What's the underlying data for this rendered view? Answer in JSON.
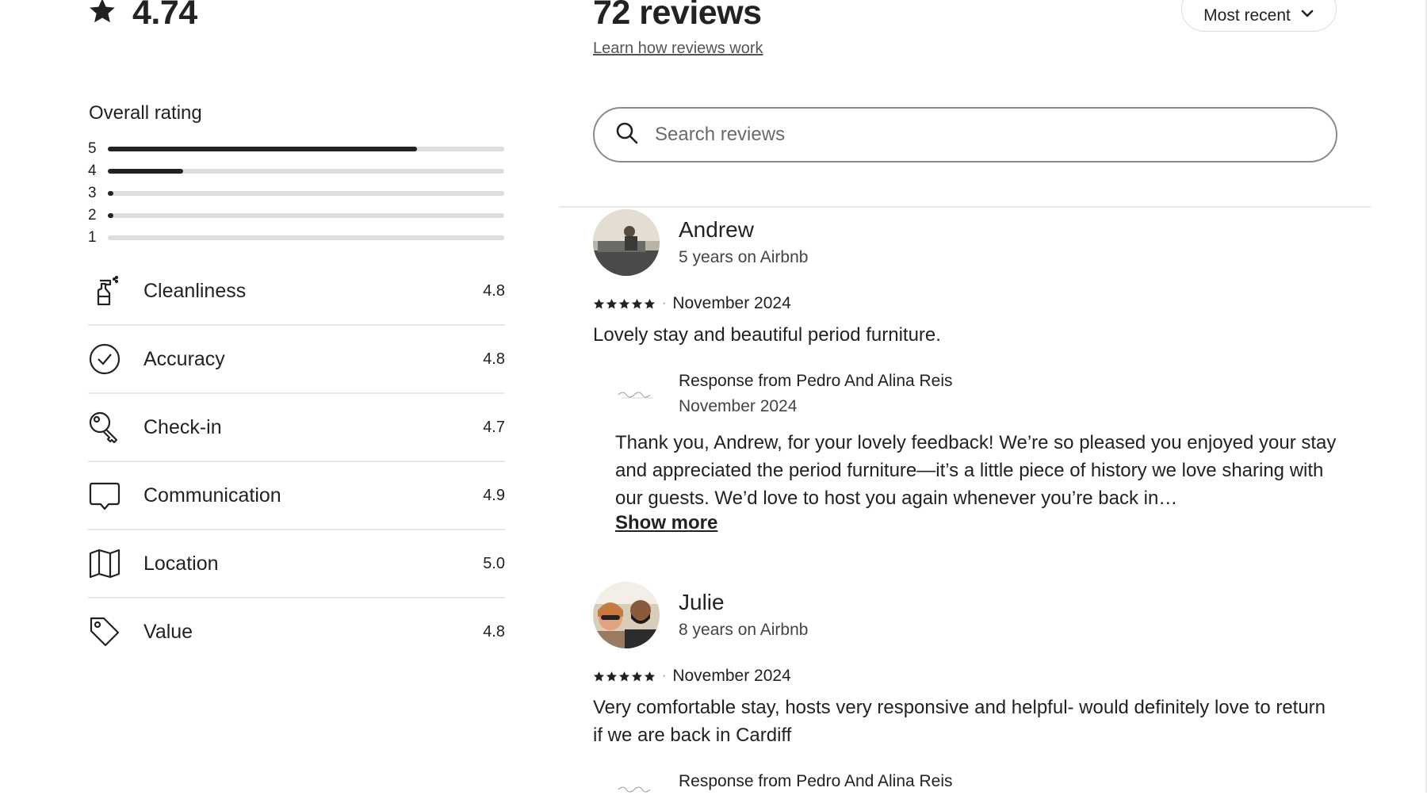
{
  "summary": {
    "rating": "4.74"
  },
  "overall": {
    "label": "Overall rating",
    "distribution": [
      {
        "star": "5",
        "fraction": 0.78
      },
      {
        "star": "4",
        "fraction": 0.19
      },
      {
        "star": "3",
        "fraction": 0.01
      },
      {
        "star": "2",
        "fraction": 0.01
      },
      {
        "star": "1",
        "fraction": 0.0
      }
    ]
  },
  "categories": [
    {
      "label": "Cleanliness",
      "score": "4.8",
      "icon": "spray-bottle-icon"
    },
    {
      "label": "Accuracy",
      "score": "4.8",
      "icon": "check-circle-icon"
    },
    {
      "label": "Check-in",
      "score": "4.7",
      "icon": "key-icon"
    },
    {
      "label": "Communication",
      "score": "4.9",
      "icon": "chat-bubble-icon"
    },
    {
      "label": "Location",
      "score": "5.0",
      "icon": "map-icon"
    },
    {
      "label": "Value",
      "score": "4.8",
      "icon": "price-tag-icon"
    }
  ],
  "reviews_header": {
    "title": "72 reviews",
    "learn_link": "Learn how reviews work",
    "sort_label": "Most recent",
    "search_placeholder": "Search reviews"
  },
  "reviews": [
    {
      "name": "Andrew",
      "tenure": "5 years on Airbnb",
      "stars": 5,
      "date": "November 2024",
      "text": "Lovely stay and beautiful period furniture.",
      "response": {
        "from": "Response from Pedro And Alina Reis",
        "date": "November 2024",
        "text": "Thank you, Andrew, for your lovely feedback! We’re so pleased you enjoyed your stay and appreciated the period furniture—it’s a little piece of history we love sharing with our guests. We’d love to host you again whenever you’re back in…",
        "show_more": "Show more"
      }
    },
    {
      "name": "Julie",
      "tenure": "8 years on Airbnb",
      "stars": 5,
      "date": "November 2024",
      "text": "Very comfortable stay, hosts very responsive and helpful- would definitely love to return if we are back in Cardiff",
      "response": {
        "from": "Response from Pedro And Alina Reis"
      }
    }
  ],
  "colors": {
    "text": "#222222",
    "track": "#dddddd",
    "fill": "#222222",
    "divider": "#e8e8e8"
  }
}
